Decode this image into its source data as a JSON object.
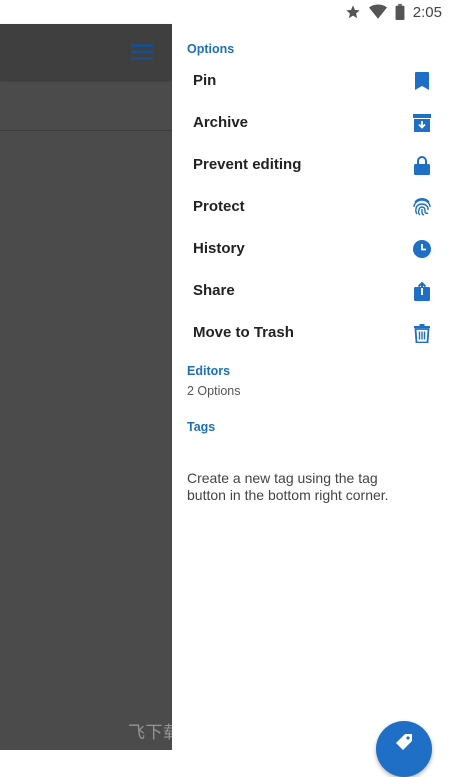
{
  "statusbar": {
    "time": "2:05",
    "icons": [
      "star-icon",
      "wifi-icon",
      "battery-icon"
    ]
  },
  "colors": {
    "accent": "#1e6fb5",
    "overlay": "#4b4b4b",
    "fab": "#1e6fc5"
  },
  "drawer": {
    "options_header": "Options",
    "options": [
      {
        "label": "Pin",
        "icon": "bookmark-icon"
      },
      {
        "label": "Archive",
        "icon": "archive-icon"
      },
      {
        "label": "Prevent editing",
        "icon": "lock-icon"
      },
      {
        "label": "Protect",
        "icon": "fingerprint-icon"
      },
      {
        "label": "History",
        "icon": "clock-icon"
      },
      {
        "label": "Share",
        "icon": "share-icon"
      },
      {
        "label": "Move to Trash",
        "icon": "trash-icon"
      }
    ],
    "editors_header": "Editors",
    "editors_count": "2 Options",
    "tags_header": "Tags",
    "tags_hint_line1": "Create a new tag using the tag",
    "tags_hint_line2": "button in the bottom right corner."
  },
  "watermark": "飞下载 • BYFZXY.COM",
  "fab": {
    "icon": "tag-icon"
  }
}
